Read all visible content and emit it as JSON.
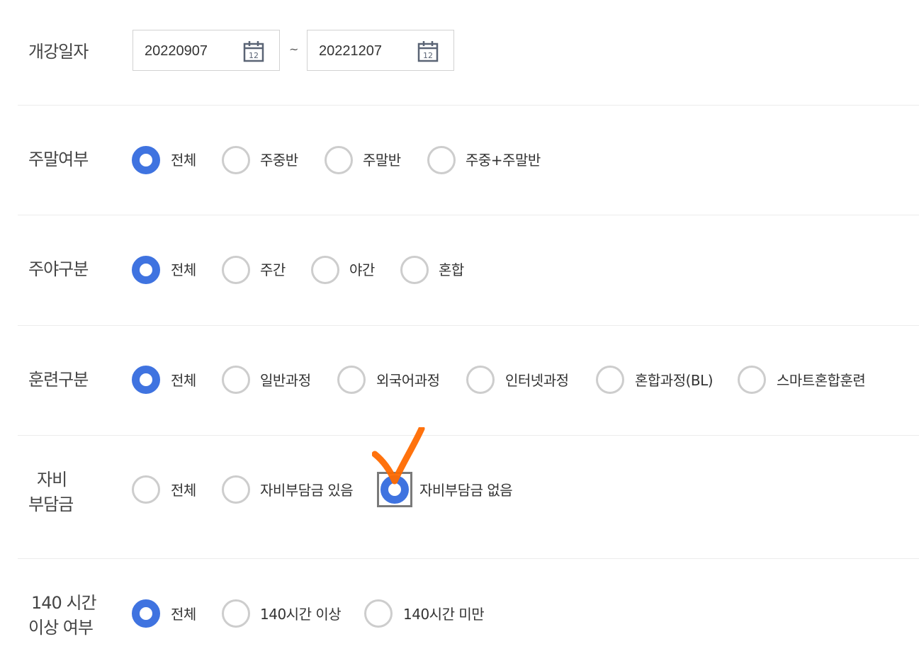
{
  "rows": [
    {
      "id": "date",
      "label": "개강일자",
      "start": "20220907",
      "end": "20221207",
      "separator": "~",
      "calendar_day": "12"
    },
    {
      "id": "weekend",
      "label": "주말여부",
      "options": [
        "전체",
        "주중반",
        "주말반",
        "주중+주말반"
      ],
      "selected": 0
    },
    {
      "id": "daynight",
      "label": "주야구분",
      "options": [
        "전체",
        "주간",
        "야간",
        "혼합"
      ],
      "selected": 0
    },
    {
      "id": "training",
      "label": "훈련구분",
      "options": [
        "전체",
        "일반과정",
        "외국어과정",
        "인터넷과정",
        "혼합과정(BL)",
        "스마트혼합훈련"
      ],
      "selected": 0
    },
    {
      "id": "copay",
      "label_line1": "자비",
      "label_line2": "부담금",
      "options": [
        "전체",
        "자비부담금 있음",
        "자비부담금 없음"
      ],
      "selected": 2
    },
    {
      "id": "hours",
      "label_line1": "140 시간",
      "label_line2": "이상 여부",
      "options": [
        "전체",
        "140시간 이상",
        "140시간 미만"
      ],
      "selected": 0
    }
  ],
  "colors": {
    "accent": "#3f73e0",
    "radio_border": "#cdcdcd",
    "annotation": "#ff6a00",
    "focus": "#7a7a7a"
  },
  "icons": {
    "calendar": "calendar-icon",
    "annotation": "checkmark-annotation-icon"
  }
}
